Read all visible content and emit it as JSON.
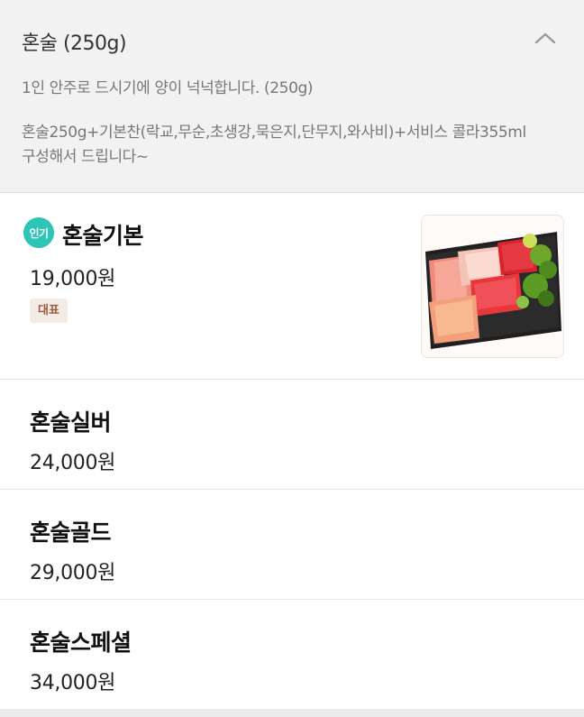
{
  "header": {
    "title": "혼술 (250g)",
    "collapse_icon": "chevron-up-icon",
    "desc_lines": [
      "1인 안주로 드시기에 양이 넉넉합니다. (250g)",
      "",
      "혼술250g+기본찬(락교,무순,초생강,묵은지,단무지,와사비)+서비스 콜라355ml",
      "구성해서 드립니다~"
    ]
  },
  "items": [
    {
      "name": "혼술기본",
      "price": "19,000원",
      "popular_badge": "인기",
      "tag": "대표",
      "image": "sashimi-platter-image"
    },
    {
      "name": "혼술실버",
      "price": "24,000원"
    },
    {
      "name": "혼술골드",
      "price": "29,000원"
    },
    {
      "name": "혼술스페셜",
      "price": "34,000원"
    }
  ],
  "colors": {
    "background": "#f2f2f2",
    "popular_badge": "#2ec4b6",
    "tag_bg": "#f3ece6",
    "tag_text": "#9a5b3a"
  }
}
